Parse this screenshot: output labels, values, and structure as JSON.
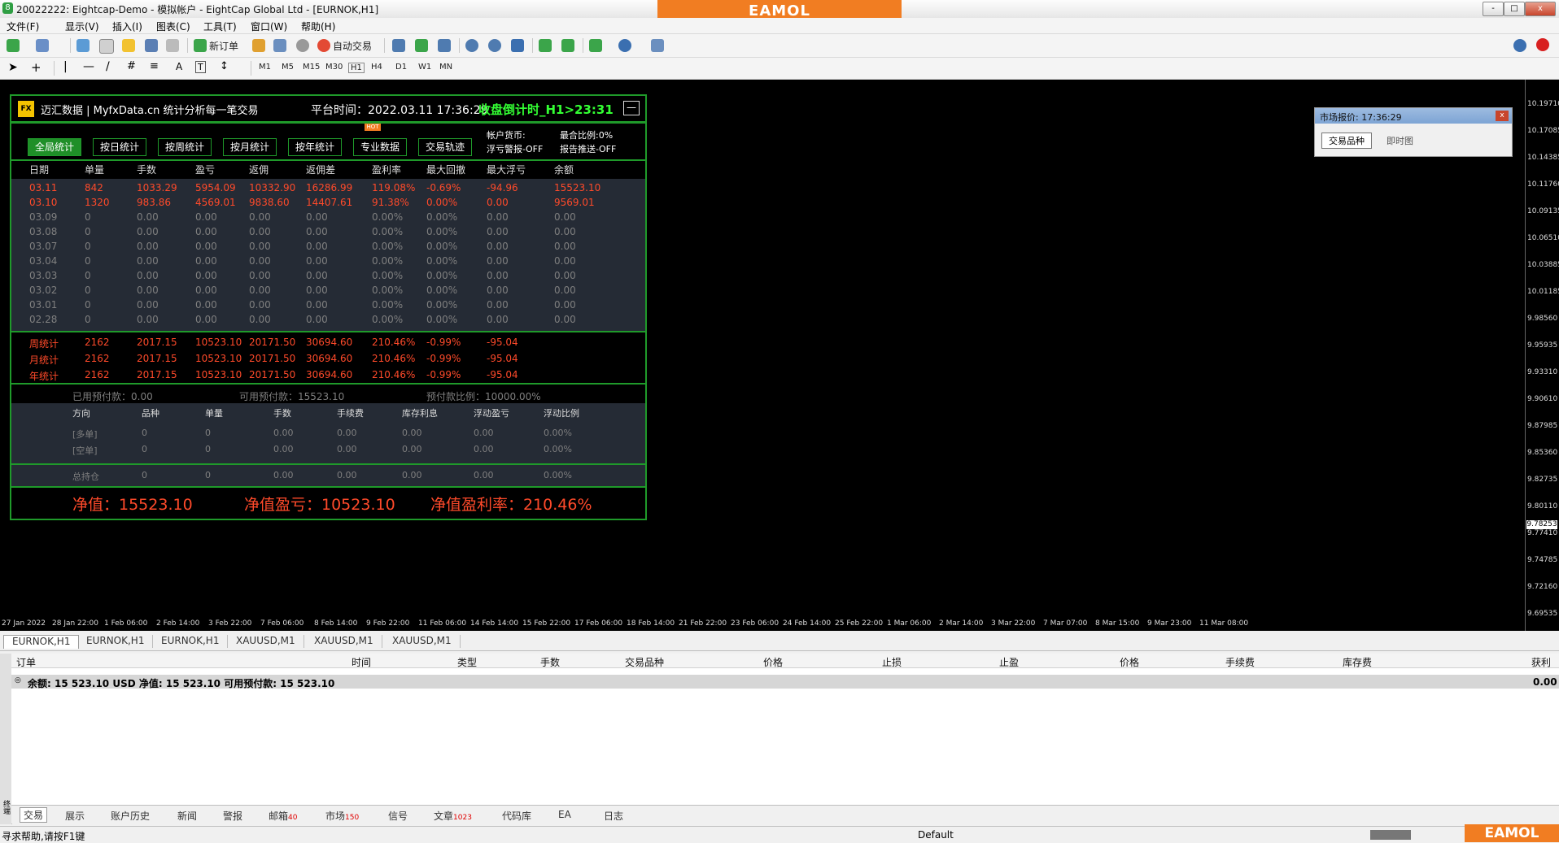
{
  "window": {
    "title": "20022222: Eightcap-Demo - 模拟帐户 - EightCap Global Ltd - [EURNOK,H1]",
    "min": "-",
    "max": "□",
    "close": "x"
  },
  "watermark": "EAMOL",
  "menu": [
    "文件(F)",
    "显示(V)",
    "插入(I)",
    "图表(C)",
    "工具(T)",
    "窗口(W)",
    "帮助(H)"
  ],
  "toolbar": {
    "new_order": "新订单",
    "auto_trade": "自动交易"
  },
  "timeframes": [
    "M1",
    "M5",
    "M15",
    "M30",
    "H1",
    "H4",
    "D1",
    "W1",
    "MN"
  ],
  "price_axis": [
    "10.19710",
    "10.17085",
    "10.14385",
    "10.11760",
    "10.09135",
    "10.06510",
    "10.03885",
    "10.01185",
    "9.98560",
    "9.95935",
    "9.93310",
    "9.90610",
    "9.87985",
    "9.85360",
    "9.82735",
    "9.80110",
    "9.77410",
    "9.74785",
    "9.72160",
    "9.69535"
  ],
  "current_price": "9.78253",
  "time_axis": [
    "27 Jan 2022",
    "28 Jan 22:00",
    "1 Feb 06:00",
    "2 Feb 14:00",
    "3 Feb 22:00",
    "7 Feb 06:00",
    "8 Feb 14:00",
    "9 Feb 22:00",
    "11 Feb 06:00",
    "14 Feb 14:00",
    "15 Feb 22:00",
    "17 Feb 06:00",
    "18 Feb 14:00",
    "21 Feb 22:00",
    "23 Feb 06:00",
    "24 Feb 14:00",
    "25 Feb 22:00",
    "1 Mar 06:00",
    "2 Mar 14:00",
    "3 Mar 22:00",
    "7 Mar 07:00",
    "8 Mar 15:00",
    "9 Mar 23:00",
    "11 Mar 08:00"
  ],
  "panel": {
    "logo": "FX",
    "brand": "迈汇数据 | MyfxData.cn  统计分析每一笔交易",
    "platform_time": "平台时间：2022.03.11 17:36:29",
    "countdown": "收盘倒计时_H1>23:31",
    "min_btn": "—",
    "tabs": [
      "全局统计",
      "按日统计",
      "按周统计",
      "按月统计",
      "按年统计",
      "专业数据",
      "交易轨迹"
    ],
    "hot": "HOT",
    "info": [
      "帐户货币:",
      "最合比例:0%",
      "浮亏警报-OFF",
      "报告推送-OFF"
    ],
    "headers": [
      "日期",
      "单量",
      "手数",
      "盈亏",
      "返佣",
      "返佣差",
      "盈利率",
      "最大回撤",
      "最大浮亏",
      "余额"
    ],
    "rows": [
      [
        "03.11",
        "842",
        "1033.29",
        "5954.09",
        "10332.90",
        "16286.99",
        "119.08%",
        "-0.69%",
        "-94.96",
        "15523.10"
      ],
      [
        "03.10",
        "1320",
        "983.86",
        "4569.01",
        "9838.60",
        "14407.61",
        "91.38%",
        "0.00%",
        "0.00",
        "9569.01"
      ],
      [
        "03.09",
        "0",
        "0.00",
        "0.00",
        "0.00",
        "0.00",
        "0.00%",
        "0.00%",
        "0.00",
        "0.00"
      ],
      [
        "03.08",
        "0",
        "0.00",
        "0.00",
        "0.00",
        "0.00",
        "0.00%",
        "0.00%",
        "0.00",
        "0.00"
      ],
      [
        "03.07",
        "0",
        "0.00",
        "0.00",
        "0.00",
        "0.00",
        "0.00%",
        "0.00%",
        "0.00",
        "0.00"
      ],
      [
        "03.04",
        "0",
        "0.00",
        "0.00",
        "0.00",
        "0.00",
        "0.00%",
        "0.00%",
        "0.00",
        "0.00"
      ],
      [
        "03.03",
        "0",
        "0.00",
        "0.00",
        "0.00",
        "0.00",
        "0.00%",
        "0.00%",
        "0.00",
        "0.00"
      ],
      [
        "03.02",
        "0",
        "0.00",
        "0.00",
        "0.00",
        "0.00",
        "0.00%",
        "0.00%",
        "0.00",
        "0.00"
      ],
      [
        "03.01",
        "0",
        "0.00",
        "0.00",
        "0.00",
        "0.00",
        "0.00%",
        "0.00%",
        "0.00",
        "0.00"
      ],
      [
        "02.28",
        "0",
        "0.00",
        "0.00",
        "0.00",
        "0.00",
        "0.00%",
        "0.00%",
        "0.00",
        "0.00"
      ]
    ],
    "summary": [
      [
        "周统计",
        "2162",
        "2017.15",
        "10523.10",
        "20171.50",
        "30694.60",
        "210.46%",
        "-0.99%",
        "-95.04"
      ],
      [
        "月统计",
        "2162",
        "2017.15",
        "10523.10",
        "20171.50",
        "30694.60",
        "210.46%",
        "-0.99%",
        "-95.04"
      ],
      [
        "年统计",
        "2162",
        "2017.15",
        "10523.10",
        "20171.50",
        "30694.60",
        "210.46%",
        "-0.99%",
        "-95.04"
      ]
    ],
    "margin_used": "已用预付款：0.00",
    "margin_free": "可用预付款：15523.10",
    "margin_level": "预付款比例：10000.00%",
    "pos_headers": [
      "方向",
      "品种",
      "单量",
      "手数",
      "手续费",
      "库存利息",
      "浮动盈亏",
      "浮动比例"
    ],
    "pos_rows": [
      [
        "[多单]",
        "0",
        "0",
        "0.00",
        "0.00",
        "0.00",
        "0.00",
        "0.00%"
      ],
      [
        "[空单]",
        "0",
        "0",
        "0.00",
        "0.00",
        "0.00",
        "0.00",
        "0.00%"
      ]
    ],
    "total_row": [
      "总持仓",
      "0",
      "0",
      "0.00",
      "0.00",
      "0.00",
      "0.00",
      "0.00%"
    ],
    "equity": "净值：15523.10",
    "equity_pl": "净值盈亏：10523.10",
    "equity_rate": "净值盈利率：210.46%"
  },
  "market_quote": {
    "title": "市场报价: 17:36:29",
    "tabs": [
      "交易品种",
      "即时图"
    ]
  },
  "chart_tabs": [
    "EURNOK,H1",
    "EURNOK,H1",
    "EURNOK,H1",
    "XAUUSD,M1",
    "XAUUSD,M1",
    "XAUUSD,M1"
  ],
  "terminal": {
    "columns": [
      "订单",
      "时间",
      "类型",
      "手数",
      "交易品种",
      "价格",
      "止损",
      "止盈",
      "价格",
      "手续费",
      "库存费",
      "获利"
    ],
    "balance": "余额: 15 523.10 USD  净值: 15 523.10  可用预付款: 15 523.10",
    "balance_profit": "0.00",
    "side_label": "终端",
    "tabs": [
      {
        "label": "交易",
        "badge": ""
      },
      {
        "label": "展示",
        "badge": ""
      },
      {
        "label": "账户历史",
        "badge": ""
      },
      {
        "label": "新闻",
        "badge": ""
      },
      {
        "label": "警报",
        "badge": ""
      },
      {
        "label": "邮箱",
        "badge": "40"
      },
      {
        "label": "市场",
        "badge": "150"
      },
      {
        "label": "信号",
        "badge": ""
      },
      {
        "label": "文章",
        "badge": "1023"
      },
      {
        "label": "代码库",
        "badge": ""
      },
      {
        "label": "EA",
        "badge": ""
      },
      {
        "label": "日志",
        "badge": ""
      }
    ]
  },
  "status": {
    "help": "寻求帮助,请按F1键",
    "profile": "Default"
  },
  "colors": {
    "accent_green": "#1f9a2a",
    "value_red": "#ff4a2a",
    "brand_orange": "#f17d22"
  }
}
